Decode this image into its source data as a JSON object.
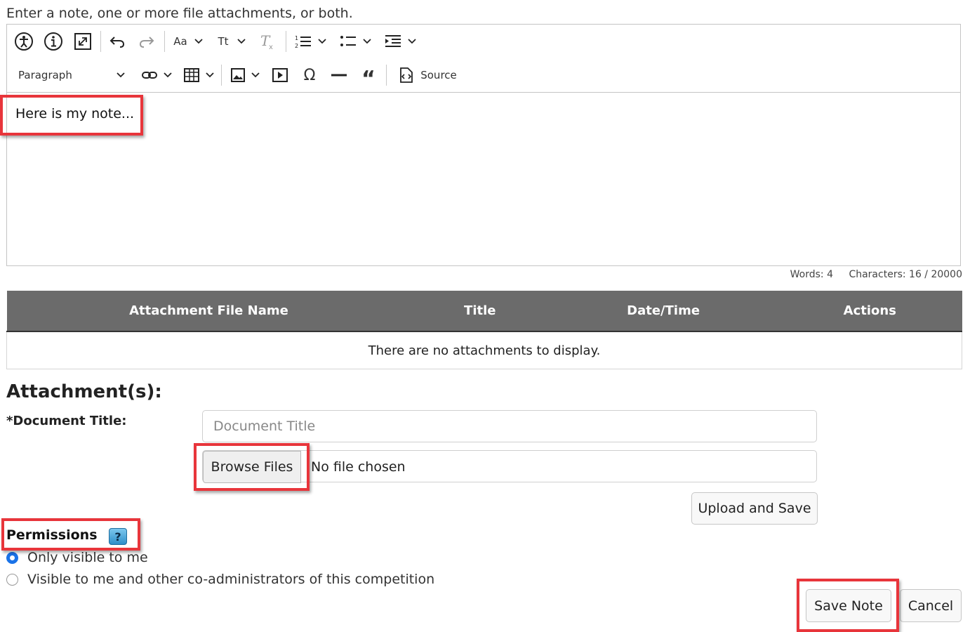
{
  "intro": "Enter a note, one or more file attachments, or both.",
  "toolbar": {
    "row1": [
      {
        "icon": "accessibility-icon"
      },
      {
        "icon": "info-icon"
      },
      {
        "icon": "fullscreen-icon"
      },
      {
        "icon": "undo-icon"
      },
      {
        "icon": "redo-icon"
      },
      {
        "icon": "font-family-icon",
        "label": "Aa"
      },
      {
        "icon": "font-size-icon",
        "label": "Tt"
      },
      {
        "icon": "remove-format-icon"
      },
      {
        "icon": "numbered-list-icon"
      },
      {
        "icon": "bulleted-list-icon"
      },
      {
        "icon": "indent-icon"
      }
    ],
    "heading_select": "Paragraph",
    "source_label": "Source"
  },
  "editor": {
    "content": "Here is my note..."
  },
  "word_count": {
    "words": "Words: 4",
    "characters": "Characters: 16 / 20000"
  },
  "attachments_table": {
    "headers": [
      "Attachment File Name",
      "Title",
      "Date/Time",
      "Actions"
    ],
    "empty_message": "There are no attachments to display."
  },
  "attachments_heading": "Attachment(s):",
  "document_title_label": "*Document Title:",
  "document_title_placeholder": "Document Title",
  "browse_label": "Browse Files",
  "no_file_text": "No file chosen",
  "upload_label": "Upload and Save",
  "permissions": {
    "label": "Permissions",
    "help": "?",
    "options": [
      {
        "label": "Only visible to me",
        "selected": true
      },
      {
        "label": "Visible to me and other co-administrators of this competition",
        "selected": false
      }
    ]
  },
  "save_label": "Save Note",
  "cancel_label": "Cancel",
  "colors": {
    "highlight": "#e8353b",
    "table_header": "#6b6b6b",
    "radio_selected": "#1a73e8"
  }
}
